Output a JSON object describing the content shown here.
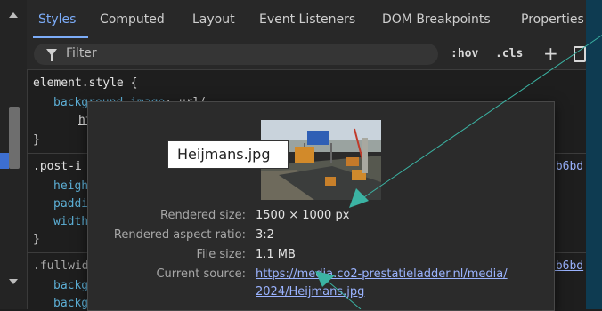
{
  "tabs": [
    {
      "label": "Styles",
      "active": true
    },
    {
      "label": "Computed"
    },
    {
      "label": "Layout"
    },
    {
      "label": "Event Listeners"
    },
    {
      "label": "DOM Breakpoints"
    },
    {
      "label": "Properties"
    }
  ],
  "filter": {
    "placeholder": "Filter",
    "hov": ":hov",
    "cls": ".cls",
    "plus": "+"
  },
  "rules": {
    "element_style": {
      "selector": "element.style {",
      "prop": "background-image",
      "value_start": ": url(",
      "url_fragment": "ht",
      "close": "}"
    },
    "post_rule": {
      "selector": ".post-i",
      "props": [
        "heigh",
        "paddi",
        "width"
      ],
      "close": "}",
      "source": "2b6bd"
    },
    "fullwidth_rule": {
      "selector": ".fullwid",
      "props": [
        "backg",
        "backg"
      ],
      "source": "2b6bd"
    }
  },
  "popup": {
    "tooltip": "Heijmans.jpg",
    "rows": [
      {
        "label": "Rendered size:",
        "value": "1500 × 1000 px"
      },
      {
        "label": "Rendered aspect ratio:",
        "value": "3:2"
      },
      {
        "label": "File size:",
        "value": "1.1 MB"
      },
      {
        "label": "Current source:",
        "value_line1": "https://media.co2-prestatieladder.nl/media/",
        "value_line2": "2024/Heijmans.jpg"
      }
    ]
  },
  "colors": {
    "accent": "#7cacf8",
    "arrow": "#3bb3a3",
    "link": "#9ab3ff",
    "property": "#5db0d7"
  },
  "icons": [
    "filter-icon",
    "plus-icon",
    "paint-icon",
    "scroll-up-icon",
    "scroll-down-icon",
    "arrow-annotation-icon"
  ]
}
